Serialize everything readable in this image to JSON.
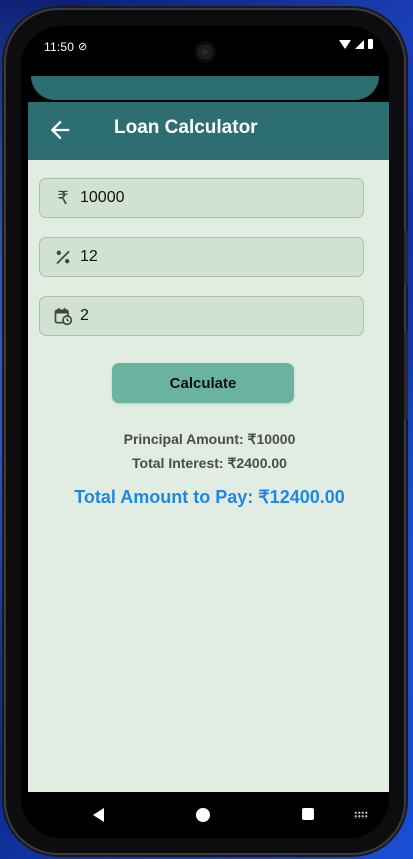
{
  "status_bar": {
    "time": "11:50"
  },
  "app_bar": {
    "title": "Loan Calculator"
  },
  "form": {
    "principal": {
      "value": "10000",
      "icon": "rupee-icon"
    },
    "rate": {
      "value": "12",
      "icon": "percent-icon"
    },
    "tenure": {
      "value": "2",
      "icon": "calendar-clock-icon"
    },
    "calculate_label": "Calculate"
  },
  "results": {
    "principal_text": "Principal Amount: ₹10000",
    "interest_text": "Total Interest: ₹2400.00",
    "total_text": "Total Amount to Pay: ₹12400.00"
  },
  "colors": {
    "app_bar": "#2d6e73",
    "background": "#e1ede2",
    "field": "#d0e2d0",
    "button": "#6ab3a0",
    "total_text": "#1e88e5"
  }
}
